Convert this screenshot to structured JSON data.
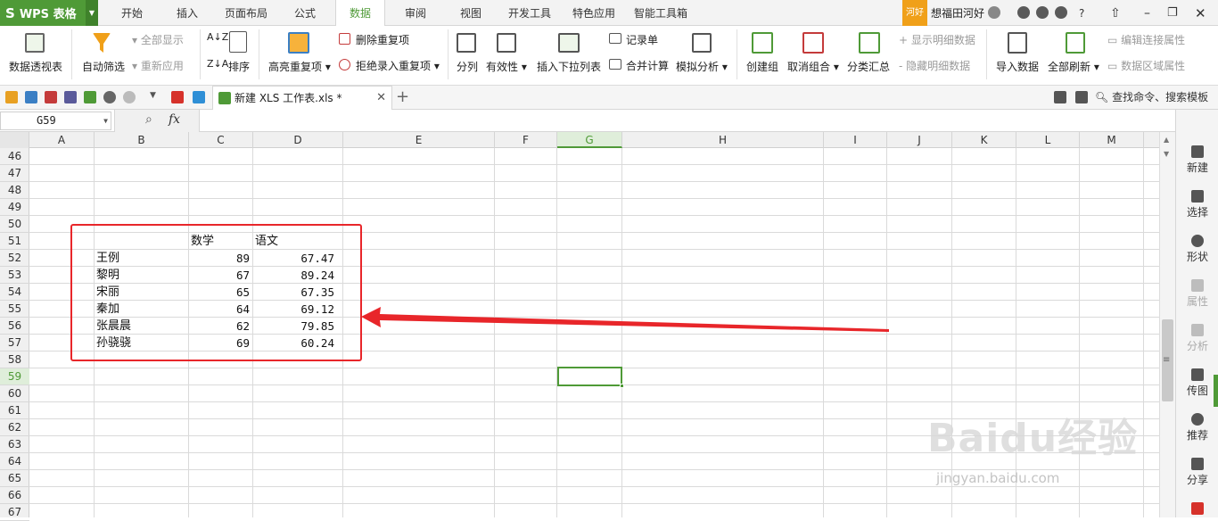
{
  "app": {
    "name": "WPS 表格"
  },
  "menu": {
    "tabs": [
      "开始",
      "插入",
      "页面布局",
      "公式",
      "数据",
      "审阅",
      "视图",
      "开发工具",
      "特色应用",
      "智能工具箱"
    ],
    "active_tab": "数据"
  },
  "user": {
    "badge": "河好",
    "name": "想福田河好",
    "help": "?"
  },
  "ribbon": {
    "pivot": "数据透视表",
    "autofilter": "自动筛选",
    "show_all": "全部显示",
    "reapply": "重新应用",
    "sort": "排序",
    "highlight_dup": "高亮重复项",
    "remove_dup": "删除重复项",
    "reject_dup": "拒绝录入重复项",
    "split": "分列",
    "validity": "有效性",
    "insert_dropdown": "插入下拉列表",
    "record_form": "记录单",
    "consolidate": "合并计算",
    "what_if": "模拟分析",
    "group": "创建组",
    "ungroup": "取消组合",
    "subtotal": "分类汇总",
    "show_detail": "显示明细数据",
    "hide_detail": "隐藏明细数据",
    "import_data": "导入数据",
    "refresh_all": "全部刷新",
    "edit_conn": "编辑连接属性",
    "data_range": "数据区域属性"
  },
  "document": {
    "tab_title": "新建 XLS 工作表.xls *",
    "search_label": "查找命令、搜索模板"
  },
  "formula_bar": {
    "cell_ref": "G59",
    "fx": "fx",
    "formula": ""
  },
  "sheet": {
    "columns": [
      "A",
      "B",
      "C",
      "D",
      "E",
      "F",
      "G",
      "H",
      "I",
      "J",
      "K",
      "L",
      "M"
    ],
    "selected_column": "G",
    "rows": [
      "46",
      "47",
      "48",
      "49",
      "50",
      "51",
      "52",
      "53",
      "54",
      "55",
      "56",
      "57",
      "58",
      "59",
      "60",
      "61",
      "62",
      "63",
      "64",
      "65",
      "66",
      "67"
    ],
    "selected_row": "59",
    "table": {
      "headers": [
        "数学",
        "语文"
      ],
      "records": [
        {
          "name": "王例",
          "math": "89",
          "chinese": "67.47"
        },
        {
          "name": "黎明",
          "math": "67",
          "chinese": "89.24"
        },
        {
          "name": "宋丽",
          "math": "65",
          "chinese": "67.35"
        },
        {
          "name": "秦加",
          "math": "64",
          "chinese": "69.12"
        },
        {
          "name": "张晨晨",
          "math": "62",
          "chinese": "79.85"
        },
        {
          "name": "孙骁骁",
          "math": "69",
          "chinese": "60.24"
        }
      ]
    }
  },
  "side_panel": [
    "新建",
    "选择",
    "形状",
    "属性",
    "分析",
    "传图",
    "推荐",
    "分享"
  ],
  "watermark": {
    "logo": "Baidu经验",
    "url": "jingyan.baidu.com"
  },
  "colors": {
    "accent": "#4f9a37",
    "highlight_box": "#e8262a",
    "arrow": "#e8262a"
  }
}
